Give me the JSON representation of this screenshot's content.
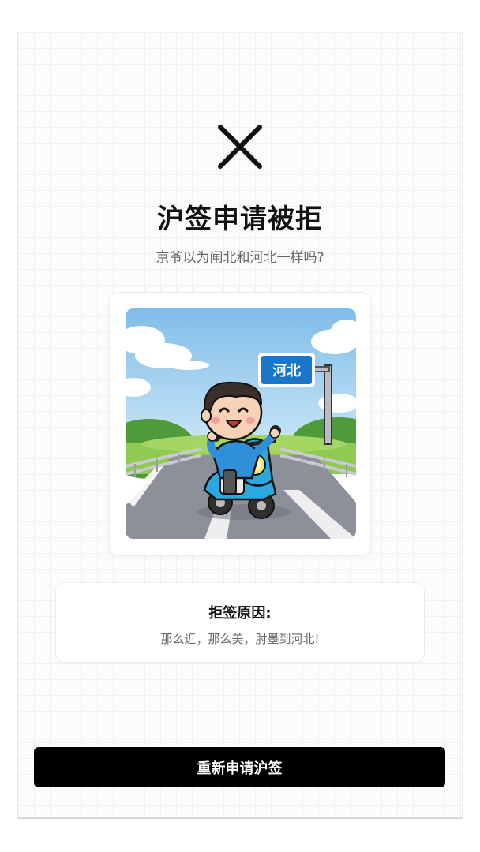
{
  "status": {
    "icon": "close-icon",
    "title": "沪签申请被拒",
    "subtitle": "京爷以为闸北和河北一样吗?"
  },
  "illustration": {
    "road_sign_text": "河北",
    "colors": {
      "sky": "#a9d3f2",
      "sign": "#1976c8",
      "grass": "#7cc04a",
      "road": "#8d8f99",
      "scooter": "#2aa8e0"
    }
  },
  "reason": {
    "title": "拒签原因:",
    "text": "那么近，那么美，肘墨到河北!"
  },
  "actions": {
    "reapply_label": "重新申请沪签"
  }
}
